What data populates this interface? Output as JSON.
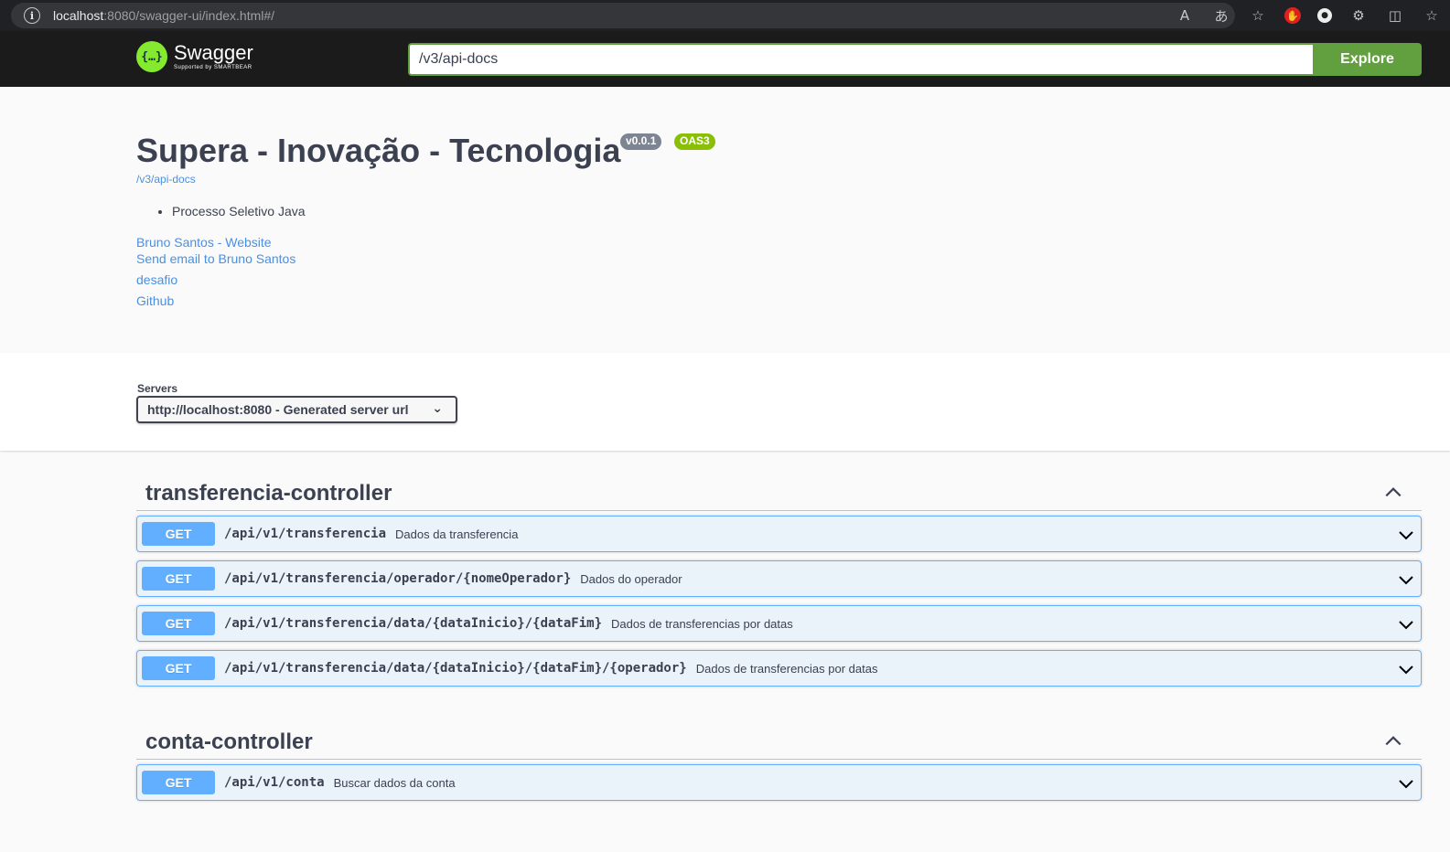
{
  "browser": {
    "url_host": "localhost",
    "url_rest": ":8080/swagger-ui/index.html#/"
  },
  "topbar": {
    "logo_name": "Swagger",
    "logo_sub": "Supported by SMARTBEAR",
    "spec_url": "/v3/api-docs",
    "explore_label": "Explore"
  },
  "info": {
    "title": "Supera - Inovação - Tecnologia",
    "version": "v0.0.1",
    "oas": "OAS3",
    "spec_link": "/v3/api-docs",
    "description_items": [
      "Processo Seletivo Java"
    ],
    "contact_website": "Bruno Santos - Website",
    "contact_email": "Send email to Bruno Santos",
    "license": "desafio",
    "external_docs": "Github"
  },
  "servers": {
    "label": "Servers",
    "selected": "http://localhost:8080 - Generated server url"
  },
  "tags": [
    {
      "name": "transferencia-controller",
      "operations": [
        {
          "method": "GET",
          "path": "/api/v1/transferencia",
          "summary": "Dados da transferencia"
        },
        {
          "method": "GET",
          "path": "/api/v1/transferencia/operador/{nomeOperador}",
          "summary": "Dados do operador"
        },
        {
          "method": "GET",
          "path": "/api/v1/transferencia/data/{dataInicio}/{dataFim}",
          "summary": "Dados de transferencias por datas"
        },
        {
          "method": "GET",
          "path": "/api/v1/transferencia/data/{dataInicio}/{dataFim}/{operador}",
          "summary": "Dados de transferencias por datas"
        }
      ]
    },
    {
      "name": "conta-controller",
      "operations": [
        {
          "method": "GET",
          "path": "/api/v1/conta",
          "summary": "Buscar dados da conta"
        }
      ]
    }
  ],
  "colors": {
    "get_method": "#61affe",
    "explore_green": "#62a03f",
    "logo_green": "#85ea2d",
    "link_blue": "#4990e2"
  }
}
